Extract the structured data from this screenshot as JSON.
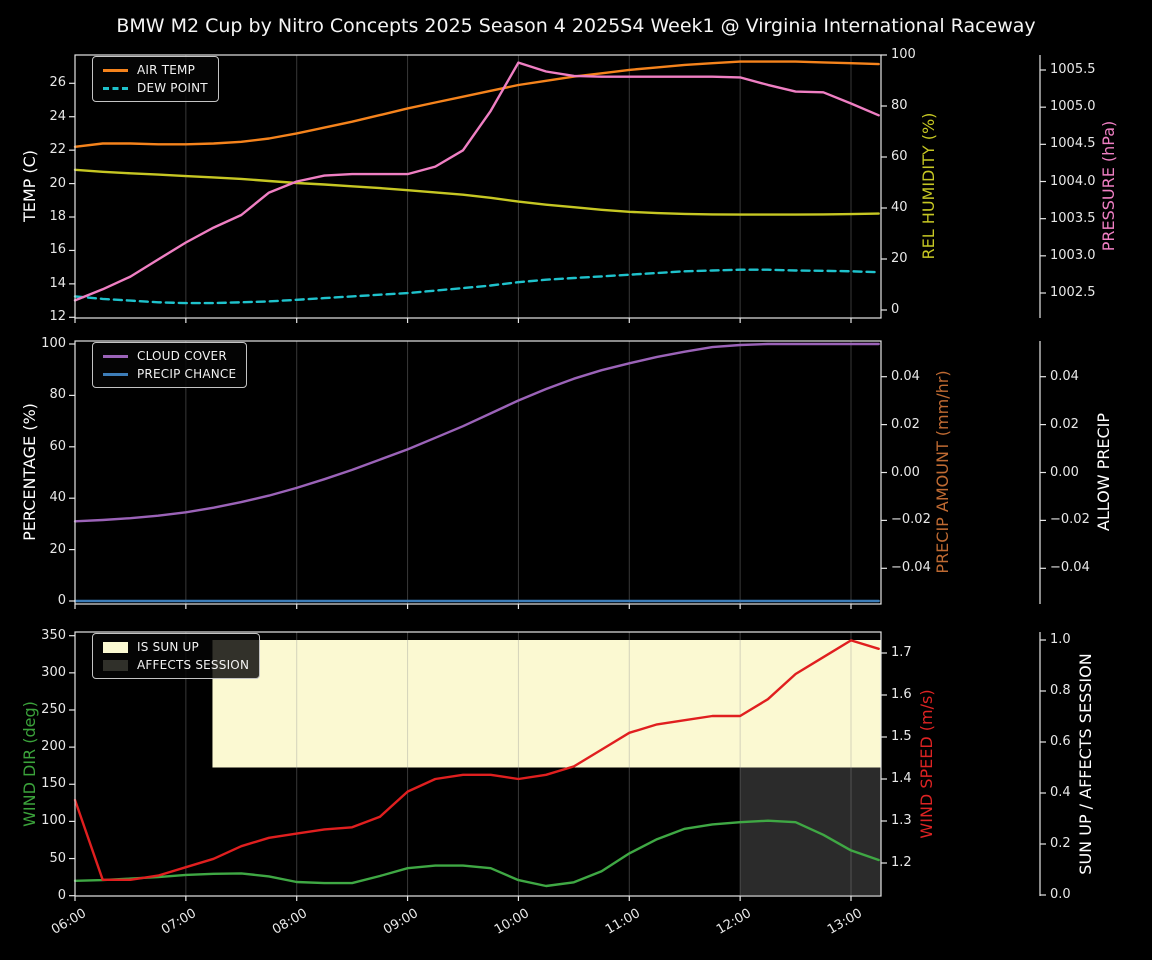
{
  "chart_data": {
    "type": "line",
    "title": "BMW M2 Cup by Nitro Concepts 2025 Season 4 2025S4 Week1 @ Virginia International Raceway",
    "x": {
      "unit": "time",
      "hours": [
        6,
        6.25,
        6.5,
        6.75,
        7,
        7.25,
        7.5,
        7.75,
        8,
        8.25,
        8.5,
        8.75,
        9,
        9.25,
        9.5,
        9.75,
        10,
        10.25,
        10.5,
        10.75,
        11,
        11.25,
        11.5,
        11.75,
        12,
        12.25,
        12.5,
        12.75,
        13,
        13.25
      ],
      "range_hours": [
        6.0,
        13.27
      ],
      "ticks": [
        {
          "h": 6,
          "label": "06:00"
        },
        {
          "h": 7,
          "label": "07:00"
        },
        {
          "h": 8,
          "label": "08:00"
        },
        {
          "h": 9,
          "label": "09:00"
        },
        {
          "h": 10,
          "label": "10:00"
        },
        {
          "h": 11,
          "label": "11:00"
        },
        {
          "h": 12,
          "label": "12:00"
        },
        {
          "h": 13,
          "label": "13:00"
        }
      ]
    },
    "grid": "vertical-hour-lines",
    "legend_position": "upper-left",
    "panels": [
      {
        "id": "temperature-humidity-pressure",
        "axes": {
          "temp": {
            "label": "TEMP (C)",
            "color": "#ffffff",
            "range": [
              12,
              26
            ],
            "tick_labels": [
              "26",
              "24",
              "22",
              "20",
              "18",
              "16",
              "14",
              "12"
            ],
            "tick_values": [
              26,
              24,
              22,
              20,
              18,
              16,
              14,
              12
            ]
          },
          "hum": {
            "label": "REL HUMIDITY (%)",
            "color": "#c6c723",
            "range": [
              0,
              100
            ],
            "tick_labels": [
              "100",
              "80",
              "60",
              "40",
              "20",
              "0"
            ],
            "tick_values": [
              100,
              80,
              60,
              40,
              20,
              0
            ]
          },
          "press": {
            "label": "PRESSURE (hPa)",
            "color": "#ef7fc3",
            "range": [
              1002.5,
              1005.5
            ],
            "tick_labels": [
              "1005.5",
              "1005.0",
              "1004.5",
              "1004.0",
              "1003.5",
              "1003.0",
              "1002.5"
            ],
            "tick_values": [
              1005.5,
              1005.0,
              1004.5,
              1004.0,
              1003.5,
              1003.0,
              1002.5
            ]
          }
        },
        "series": [
          {
            "name": "AIR TEMP",
            "axis": "temp",
            "color": "#f5831c",
            "dash": false,
            "values": [
              22.2,
              22.4,
              22.4,
              22.35,
              22.35,
              22.4,
              22.5,
              22.7,
              23.0,
              23.35,
              23.7,
              24.1,
              24.5,
              24.85,
              25.2,
              25.55,
              25.9,
              26.15,
              26.4,
              26.6,
              26.8,
              26.95,
              27.1,
              27.2,
              27.3,
              27.3,
              27.3,
              27.25,
              27.2,
              27.15
            ]
          },
          {
            "name": "DEW POINT",
            "axis": "temp",
            "color": "#1fc2cc",
            "dash": true,
            "values": [
              13.25,
              13.1,
              13.0,
              12.9,
              12.85,
              12.85,
              12.9,
              12.95,
              13.05,
              13.15,
              13.25,
              13.35,
              13.45,
              13.6,
              13.75,
              13.9,
              14.1,
              14.25,
              14.35,
              14.45,
              14.55,
              14.65,
              14.75,
              14.8,
              14.85,
              14.85,
              14.8,
              14.78,
              14.75,
              14.7
            ]
          },
          {
            "name": "REL HUMIDITY",
            "axis": "hum",
            "color": "#c6c723",
            "dash": false,
            "values": [
              55,
              54.2,
              53.6,
              53.1,
              52.5,
              52,
              51.4,
              50.6,
              49.8,
              49.2,
              48.5,
              47.8,
              47,
              46.1,
              45.2,
              44,
              42.5,
              41.3,
              40.3,
              39.3,
              38.5,
              38,
              37.7,
              37.5,
              37.4,
              37.4,
              37.4,
              37.5,
              37.6,
              37.8
            ]
          },
          {
            "name": "PRESSURE",
            "axis": "press",
            "color": "#ef7fc3",
            "dash": false,
            "values": [
              1002.4,
              1002.55,
              1002.72,
              1002.95,
              1003.18,
              1003.38,
              1003.55,
              1003.85,
              1004.0,
              1004.08,
              1004.1,
              1004.1,
              1004.1,
              1004.2,
              1004.42,
              1004.95,
              1005.6,
              1005.48,
              1005.42,
              1005.41,
              1005.41,
              1005.41,
              1005.41,
              1005.41,
              1005.4,
              1005.3,
              1005.21,
              1005.2,
              1005.05,
              1004.89
            ]
          }
        ],
        "legend_items": [
          {
            "label": "AIR TEMP",
            "color": "#f5831c",
            "style": "line"
          },
          {
            "label": "DEW POINT",
            "color": "#1fc2cc",
            "style": "dashed"
          }
        ]
      },
      {
        "id": "cloud-precip",
        "axes": {
          "pct": {
            "label": "PERCENTAGE (%)",
            "color": "#ffffff",
            "range": [
              0,
              100
            ],
            "tick_labels": [
              "100",
              "80",
              "60",
              "40",
              "20",
              "0"
            ],
            "tick_values": [
              100,
              80,
              60,
              40,
              20,
              0
            ]
          },
          "amt": {
            "label": "PRECIP AMOUNT (mm/hr)",
            "color": "#bf6a32",
            "range": [
              -0.04,
              0.04
            ],
            "tick_labels": [
              "0.04",
              "0.02",
              "0.00",
              "−0.02",
              "−0.04"
            ],
            "tick_values": [
              0.04,
              0.02,
              0,
              -0.02,
              -0.04
            ]
          },
          "allow": {
            "label": "ALLOW PRECIP",
            "color": "#ffffff",
            "range": [
              -0.04,
              0.04
            ],
            "tick_labels": [
              "0.04",
              "0.02",
              "0.00",
              "−0.02",
              "−0.04"
            ],
            "tick_values": [
              0.04,
              0.02,
              0,
              -0.02,
              -0.04
            ]
          }
        },
        "series": [
          {
            "name": "CLOUD COVER",
            "axis": "pct",
            "color": "#9b63b8",
            "dash": false,
            "values": [
              31,
              31.5,
              32.2,
              33.2,
              34.5,
              36.3,
              38.5,
              41,
              44,
              47.4,
              51,
              55,
              59,
              63.5,
              68,
              73,
              78,
              82.5,
              86.5,
              89.8,
              92.5,
              95,
              97,
              98.8,
              99.6,
              100,
              100,
              100,
              100,
              100
            ]
          },
          {
            "name": "PRECIP CHANCE",
            "axis": "pct",
            "color": "#3d7db8",
            "dash": false,
            "values": [
              0,
              0,
              0,
              0,
              0,
              0,
              0,
              0,
              0,
              0,
              0,
              0,
              0,
              0,
              0,
              0,
              0,
              0,
              0,
              0,
              0,
              0,
              0,
              0,
              0,
              0,
              0,
              0,
              0,
              0
            ]
          }
        ],
        "legend_items": [
          {
            "label": "CLOUD COVER",
            "color": "#9b63b8",
            "style": "line"
          },
          {
            "label": "PRECIP CHANCE",
            "color": "#3d7db8",
            "style": "line"
          }
        ]
      },
      {
        "id": "wind-sun",
        "axes": {
          "deg": {
            "label": "WIND DIR (deg)",
            "color": "#3ba33b",
            "range": [
              0,
              350
            ],
            "tick_labels": [
              "350",
              "300",
              "250",
              "200",
              "150",
              "100",
              "50",
              "0"
            ],
            "tick_values": [
              350,
              300,
              250,
              200,
              150,
              100,
              50,
              0
            ]
          },
          "ms": {
            "label": "WIND SPEED (m/s)",
            "color": "#de2323",
            "range": [
              1.2,
              1.7
            ],
            "tick_labels": [
              "1.7",
              "1.6",
              "1.5",
              "1.4",
              "1.3",
              "1.2"
            ],
            "tick_values": [
              1.7,
              1.6,
              1.5,
              1.4,
              1.3,
              1.2
            ]
          },
          "sun": {
            "label": "SUN UP / AFFECTS SESSION",
            "color": "#ffffff",
            "range": [
              0,
              1
            ],
            "tick_labels": [
              "1.0",
              "0.8",
              "0.6",
              "0.4",
              "0.2",
              "0.0"
            ],
            "tick_values": [
              1.0,
              0.8,
              0.6,
              0.4,
              0.2,
              0.0
            ]
          }
        },
        "regions": [
          {
            "name": "IS SUN UP",
            "color": "#fbf9d2",
            "x_hours": [
              7.24,
              13.27
            ],
            "y_axis": "sun",
            "y_range": [
              0.5,
              1.0
            ]
          },
          {
            "name": "AFFECTS SESSION",
            "color": "#2b2b2b",
            "x_hours": [
              12.0,
              13.27
            ],
            "y_axis": "sun",
            "y_range": [
              0.0,
              0.5
            ]
          }
        ],
        "series": [
          {
            "name": "WIND DIR",
            "axis": "deg",
            "color": "#3fa844",
            "dash": false,
            "values": [
              20,
              21,
              23,
              25,
              28,
              29.5,
              30,
              26,
              18.5,
              17,
              17,
              26.5,
              37,
              40.5,
              40.5,
              37,
              21,
              13,
              18,
              33,
              57,
              76,
              90,
              96,
              99,
              101,
              99,
              82,
              61,
              48
            ]
          },
          {
            "name": "WIND SPEED",
            "axis": "ms",
            "color": "#e01f1f",
            "dash": false,
            "values": [
              1.35,
              1.16,
              1.16,
              1.17,
              1.19,
              1.21,
              1.24,
              1.26,
              1.27,
              1.28,
              1.285,
              1.31,
              1.37,
              1.4,
              1.41,
              1.41,
              1.4,
              1.41,
              1.43,
              1.47,
              1.51,
              1.53,
              1.54,
              1.55,
              1.55,
              1.59,
              1.65,
              1.69,
              1.73,
              1.71
            ]
          }
        ],
        "legend_items": [
          {
            "label": "IS SUN UP",
            "color": "#fbf9d2",
            "style": "patch"
          },
          {
            "label": "AFFECTS SESSION",
            "color": "#30302a",
            "style": "patch"
          }
        ]
      }
    ]
  }
}
